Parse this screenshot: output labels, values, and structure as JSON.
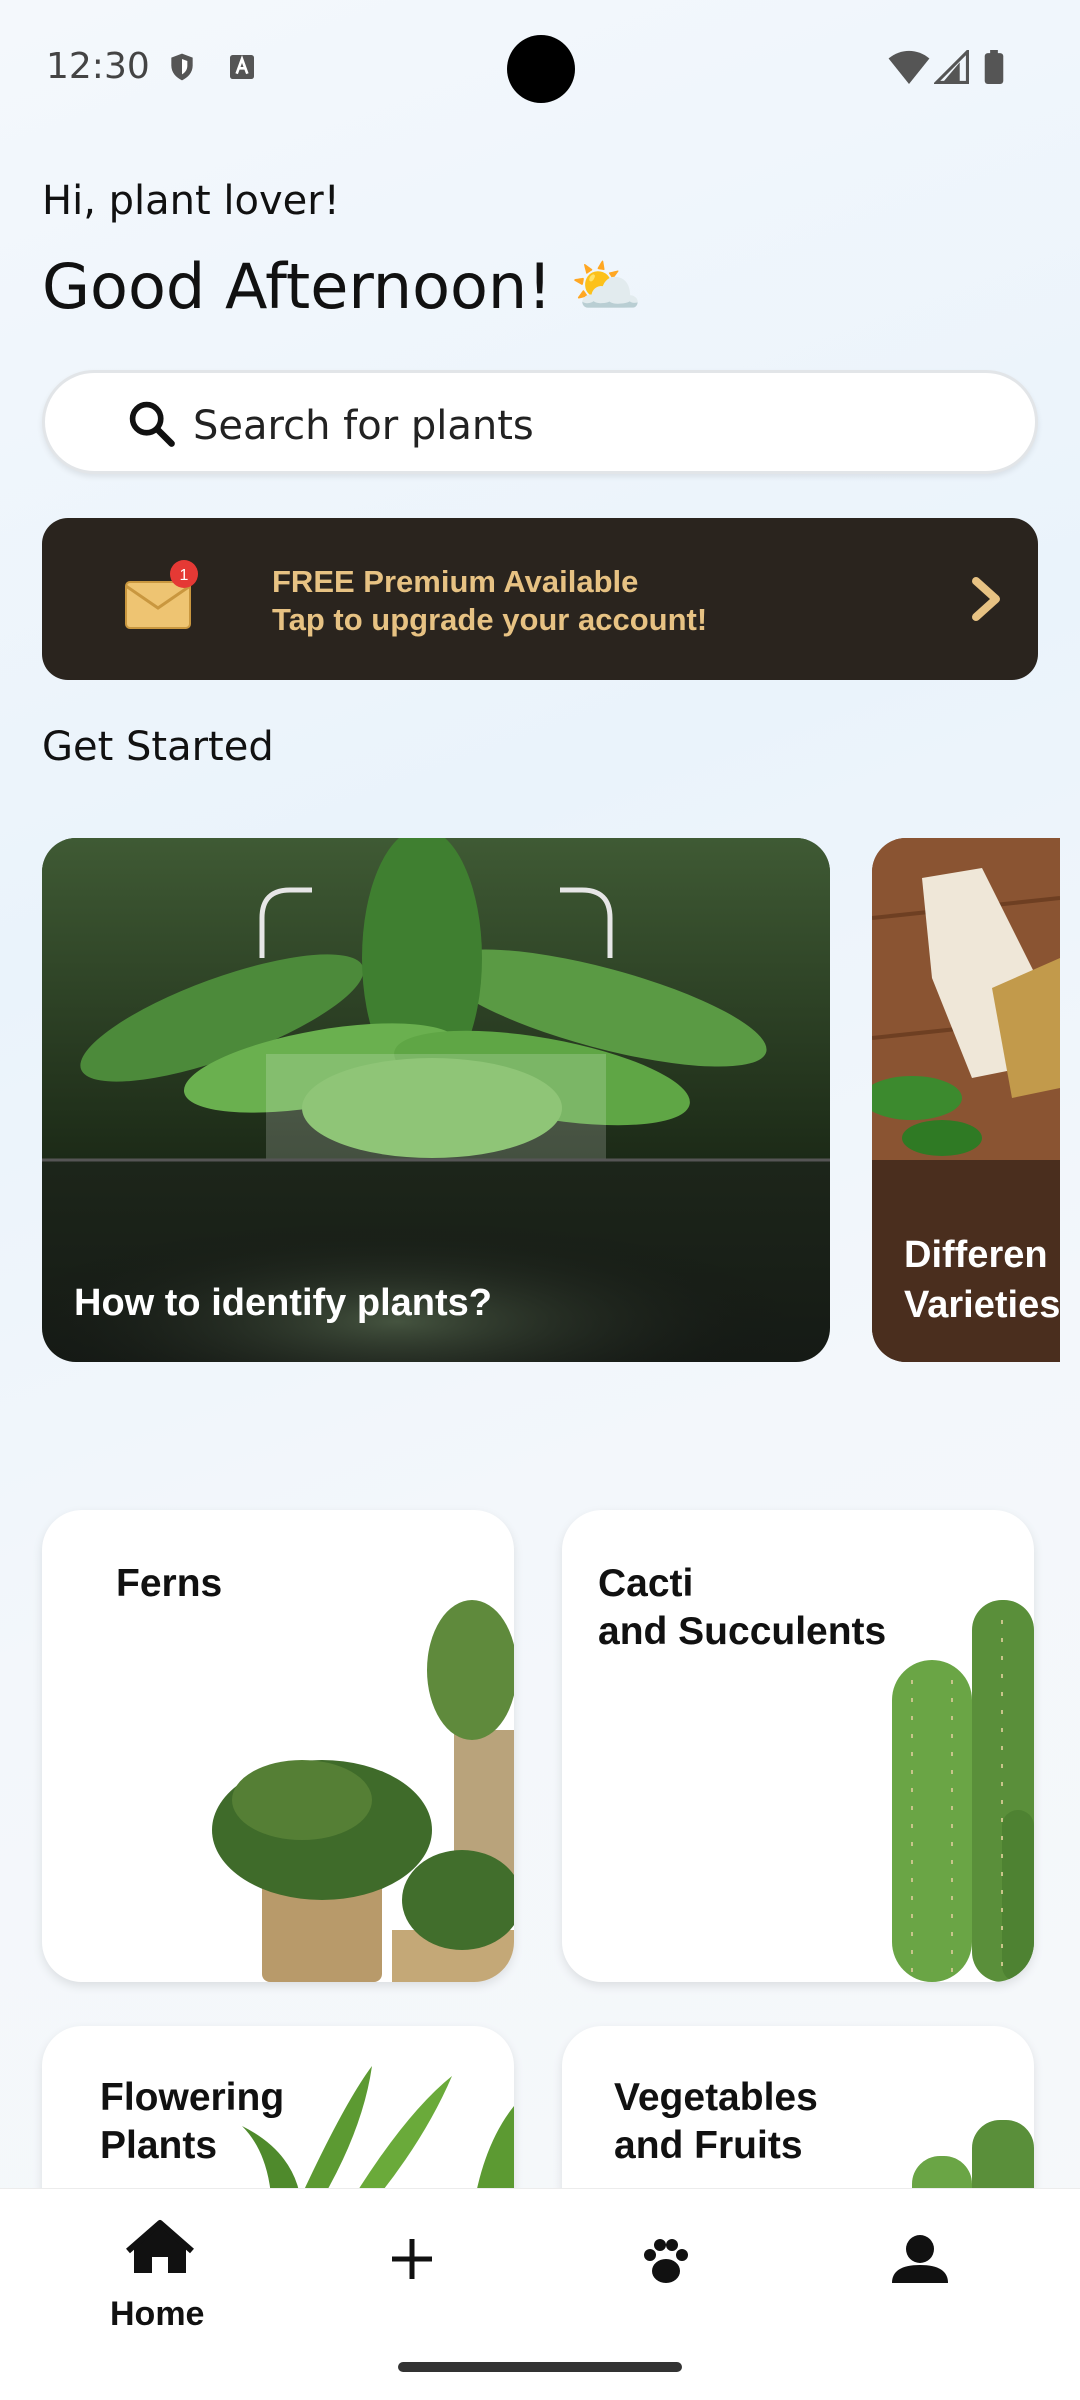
{
  "status_bar": {
    "time": "12:30",
    "icons": [
      "shield-icon",
      "a-icon",
      "wifi-icon",
      "signal-icon",
      "battery-icon"
    ]
  },
  "header": {
    "greeting": "Hi, plant lover!",
    "title": "Good Afternoon!",
    "weather_emoji": "⛅"
  },
  "search": {
    "placeholder": "Search for plants"
  },
  "promo": {
    "line1": "FREE Premium Available",
    "line2": "Tap to upgrade your account!",
    "badge_count": "1"
  },
  "get_started": {
    "title": "Get Started",
    "cards": [
      {
        "label": "How to identify plants?"
      },
      {
        "label": "Differen\nVarieties"
      }
    ]
  },
  "categories": [
    {
      "label": "Ferns"
    },
    {
      "label": "Cacti\nand Succulents"
    },
    {
      "label": "Flowering\nPlants"
    },
    {
      "label": "Vegetables\nand Fruits"
    }
  ],
  "nav": {
    "home_label": "Home",
    "items": [
      "home-icon",
      "add-icon",
      "paw-icon",
      "profile-icon"
    ]
  },
  "colors": {
    "promo_bg": "#2a241e",
    "promo_text": "#e7c283",
    "badge": "#e53935"
  }
}
